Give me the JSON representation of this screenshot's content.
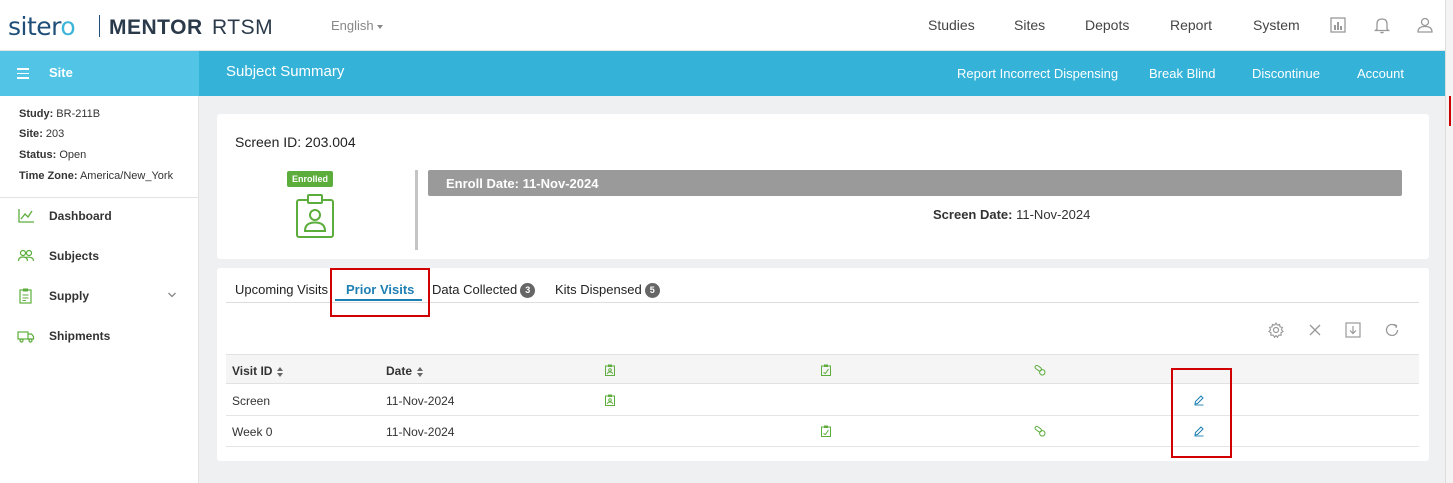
{
  "brand": {
    "logo_pre": "siter",
    "logo_o": "o",
    "mentor": "MENTOR",
    "rtsm": "RTSM"
  },
  "topnav": {
    "language": "English",
    "items": [
      "Studies",
      "Sites",
      "Depots",
      "Report",
      "System"
    ],
    "icons": [
      "report-chart-icon",
      "bell-icon",
      "user-icon"
    ]
  },
  "sidebar": {
    "title": "Site",
    "meta": [
      {
        "label": "Study",
        "value": "BR-211B"
      },
      {
        "label": "Site",
        "value": "203"
      },
      {
        "label": "Status",
        "value": "Open"
      },
      {
        "label": "Time Zone",
        "value": "America/New_York"
      }
    ],
    "items": [
      {
        "label": "Dashboard",
        "icon": "chart-line-icon"
      },
      {
        "label": "Subjects",
        "icon": "users-icon"
      },
      {
        "label": "Supply",
        "icon": "clipboard-icon",
        "expandable": true
      },
      {
        "label": "Shipments",
        "icon": "truck-icon"
      }
    ]
  },
  "header": {
    "title": "Subject Summary",
    "actions": [
      "Report Incorrect Dispensing",
      "Break Blind",
      "Discontinue",
      "Account"
    ]
  },
  "summary": {
    "screen_id": "Screen ID: 203.004",
    "status_badge": "Enrolled",
    "enroll_date": "Enroll Date: 11-Nov-2024",
    "screen_date_label": "Screen Date:",
    "screen_date_value": "11-Nov-2024"
  },
  "tabs": [
    {
      "label": "Upcoming Visits"
    },
    {
      "label": "Prior Visits",
      "active": true
    },
    {
      "label": "Data Collected",
      "count": "3"
    },
    {
      "label": "Kits Dispensed",
      "count": "5"
    }
  ],
  "toolbar_icons": [
    "settings-icon",
    "close-icon",
    "download-icon",
    "refresh-icon"
  ],
  "table": {
    "columns": [
      "Visit ID",
      "Date"
    ],
    "rows": [
      {
        "visit_id": "Screen",
        "date": "11-Nov-2024"
      },
      {
        "visit_id": "Week 0",
        "date": "11-Nov-2024"
      }
    ]
  },
  "colors": {
    "accent": "#34b2d8",
    "sidebar_header": "#52c5e6",
    "green": "#5cad3c",
    "tab_active": "#1e7fb3",
    "highlight": "#d10000"
  }
}
